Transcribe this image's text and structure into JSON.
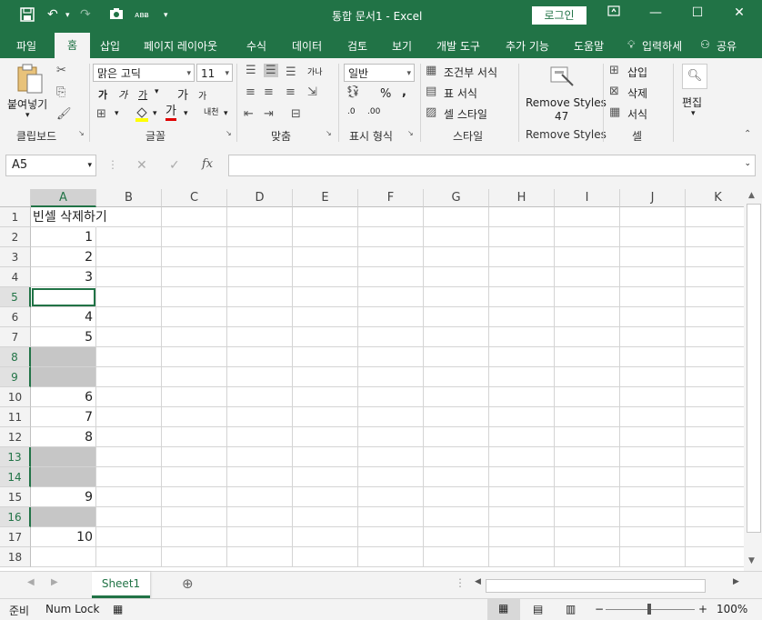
{
  "window": {
    "title": "통합 문서1  -  Excel",
    "login_label": "로그인",
    "minimize_icon": "minimize-icon",
    "restore_icon": "restore-icon",
    "close_icon": "close-icon"
  },
  "tabs": [
    {
      "label": "파일"
    },
    {
      "label": "홈"
    },
    {
      "label": "삽입"
    },
    {
      "label": "페이지 레이아웃"
    },
    {
      "label": "수식"
    },
    {
      "label": "데이터"
    },
    {
      "label": "검토"
    },
    {
      "label": "보기"
    },
    {
      "label": "개발 도구"
    },
    {
      "label": "추가 기능"
    },
    {
      "label": "도움말"
    },
    {
      "label": "입력하세"
    },
    {
      "label": "공유"
    }
  ],
  "ribbon": {
    "clipboard": {
      "paste_label": "붙여넣기",
      "group_label": "클립보드"
    },
    "font": {
      "font_name": "맑은 고딕",
      "font_size": "11",
      "group_label": "글꼴",
      "bold": "가",
      "italic": "가",
      "underline": "가",
      "grow": "가",
      "shrink": "가",
      "color_a": "가",
      "phonetic": "내천"
    },
    "alignment": {
      "group_label": "맞춤",
      "wrap_icon": "가나"
    },
    "number": {
      "format": "일반",
      "percent": "%",
      "comma": ",",
      "group_label": "표시 형식",
      "dec_inc": ".0",
      "dec_dec": ".00"
    },
    "styles": {
      "conditional": "조건부 서식",
      "table": "표 서식",
      "cell": "셀 스타일",
      "group_label": "스타일"
    },
    "remove_styles": {
      "label_line1": "Remove Styles",
      "label_line2": "47",
      "group_label": "Remove Styles"
    },
    "cells": {
      "insert": "삽입",
      "delete": "삭제",
      "format": "서식",
      "group_label": "셀"
    },
    "editing": {
      "label": "편집"
    }
  },
  "formula_bar": {
    "name_box": "A5",
    "cancel": "✕",
    "enter": "✓",
    "fx": "fx",
    "value": ""
  },
  "columns": [
    "A",
    "B",
    "C",
    "D",
    "E",
    "F",
    "G",
    "H",
    "I",
    "J",
    "K"
  ],
  "rows": [
    {
      "num": "1",
      "a": "빈셀 삭제하기",
      "kind": "text",
      "selected": false
    },
    {
      "num": "2",
      "a": "1",
      "kind": "num",
      "selected": false
    },
    {
      "num": "3",
      "a": "2",
      "kind": "num",
      "selected": false
    },
    {
      "num": "4",
      "a": "3",
      "kind": "num",
      "selected": false
    },
    {
      "num": "5",
      "a": "",
      "kind": "active",
      "selected": true
    },
    {
      "num": "6",
      "a": "4",
      "kind": "num",
      "selected": false
    },
    {
      "num": "7",
      "a": "5",
      "kind": "num",
      "selected": false
    },
    {
      "num": "8",
      "a": "",
      "kind": "blanksel",
      "selected": true
    },
    {
      "num": "9",
      "a": "",
      "kind": "blanksel",
      "selected": true
    },
    {
      "num": "10",
      "a": "6",
      "kind": "num",
      "selected": false
    },
    {
      "num": "11",
      "a": "7",
      "kind": "num",
      "selected": false
    },
    {
      "num": "12",
      "a": "8",
      "kind": "num",
      "selected": false
    },
    {
      "num": "13",
      "a": "",
      "kind": "blanksel",
      "selected": true
    },
    {
      "num": "14",
      "a": "",
      "kind": "blanksel",
      "selected": true
    },
    {
      "num": "15",
      "a": "9",
      "kind": "num",
      "selected": false
    },
    {
      "num": "16",
      "a": "",
      "kind": "blanksel",
      "selected": true
    },
    {
      "num": "17",
      "a": "10",
      "kind": "num",
      "selected": false
    },
    {
      "num": "18",
      "a": "",
      "kind": "empty",
      "selected": false
    }
  ],
  "sheets": [
    {
      "label": "Sheet1"
    }
  ],
  "status": {
    "mode": "준비",
    "numlock": "Num Lock",
    "zoom": "100%",
    "minus": "−",
    "plus": "+"
  },
  "colors": {
    "accent": "#217346",
    "selection": "#c6c6c6"
  }
}
